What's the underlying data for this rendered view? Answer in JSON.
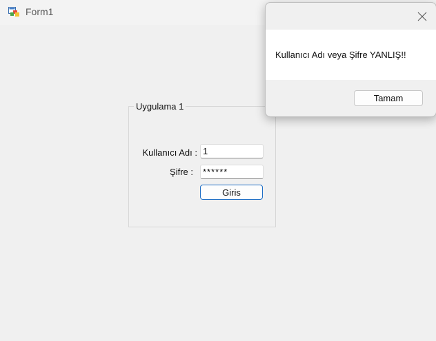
{
  "window": {
    "title": "Form1",
    "icon": "winforms-app-icon"
  },
  "groupbox": {
    "title": "Uygulama 1"
  },
  "login": {
    "username_label": "Kullanıcı Adı :",
    "username_value": "1",
    "password_label": "Şifre :",
    "password_value": "******",
    "submit_label": "Giris"
  },
  "message_box": {
    "message": "Kullanıcı Adı veya Şifre YANLIŞ!!",
    "ok_label": "Tamam",
    "close_icon": "close-icon"
  },
  "colors": {
    "background": "#f0f0f0",
    "accent_border": "#1f6fc6",
    "dialog_body": "#ffffff"
  }
}
